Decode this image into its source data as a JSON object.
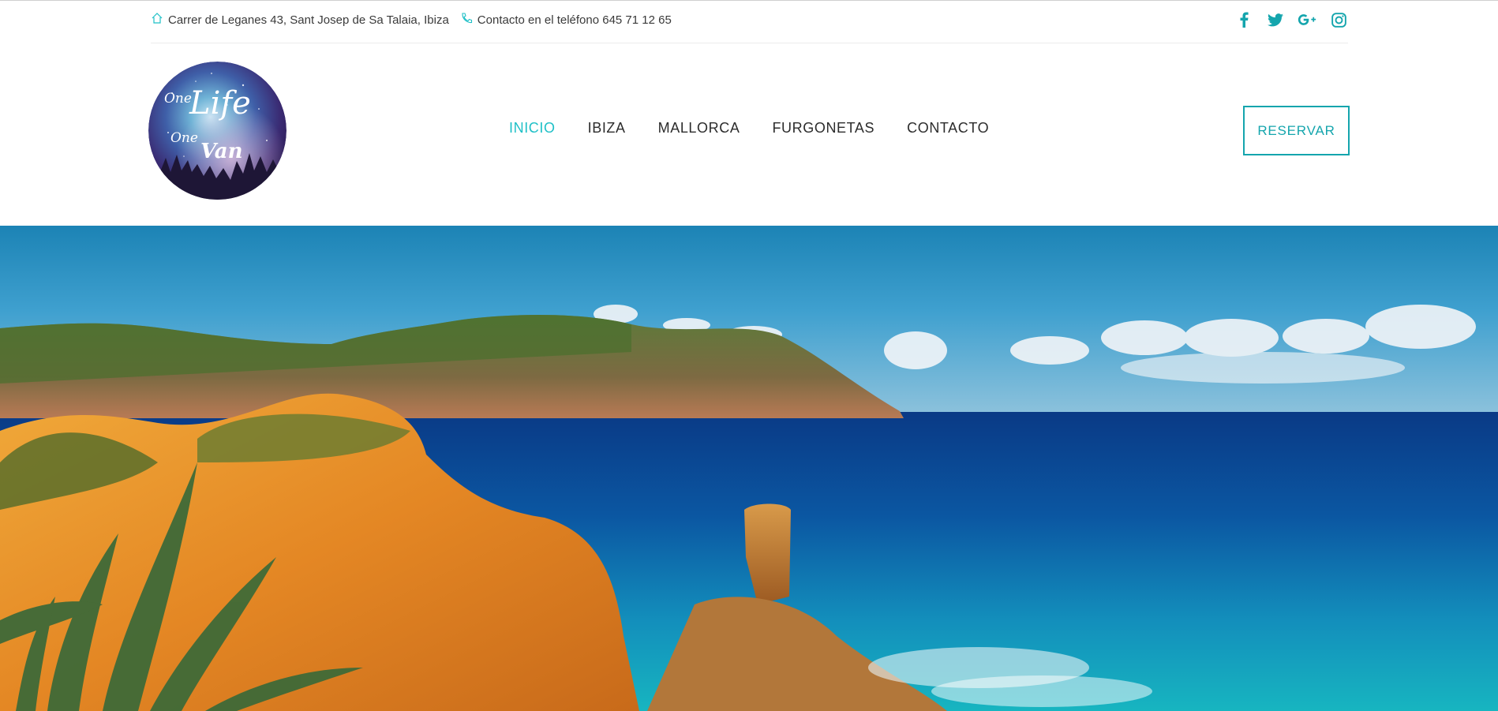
{
  "topbar": {
    "address": "Carrer de Leganes 43, Sant Josep de Sa Talaia, Ibiza",
    "phone": "Contacto en el teléfono 645 71 12 65",
    "social": [
      "facebook-icon",
      "twitter-icon",
      "google-plus-icon",
      "instagram-icon"
    ]
  },
  "logo": {
    "line1": "One",
    "line2": "Life",
    "line3": "One",
    "line4": "Van"
  },
  "nav": {
    "items": [
      {
        "label": "INICIO",
        "active": true
      },
      {
        "label": "IBIZA",
        "active": false
      },
      {
        "label": "MALLORCA",
        "active": false
      },
      {
        "label": "FURGONETAS",
        "active": false
      },
      {
        "label": "CONTACTO",
        "active": false
      }
    ]
  },
  "cta": {
    "label": "RESERVAR"
  },
  "colors": {
    "accent": "#1fc0c7",
    "button": "#14a5ad",
    "icon": "#14a5ad"
  }
}
